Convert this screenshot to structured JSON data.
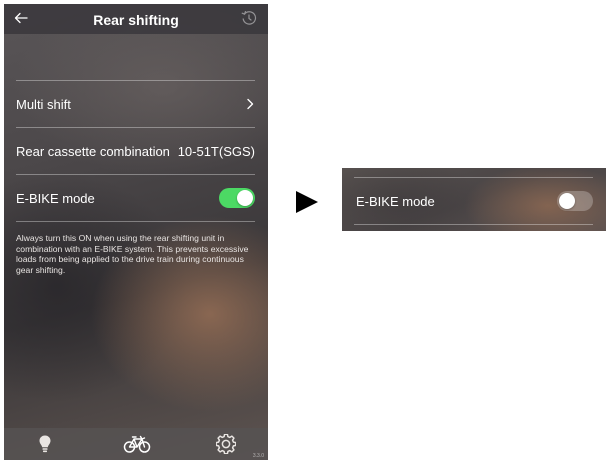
{
  "phone": {
    "header": {
      "title": "Rear shifting",
      "back_icon": "back-arrow-icon",
      "restore_icon": "restore-icon"
    },
    "rows": [
      {
        "label": "Multi shift",
        "value": "",
        "control": "chevron"
      },
      {
        "label": "Rear cassette combination",
        "value": "10-51T(SGS)",
        "control": "value"
      },
      {
        "label": "E-BIKE mode",
        "value": "",
        "control": "toggle",
        "toggle_on": true
      }
    ],
    "note": "Always turn this ON when using the rear shifting unit in combination with an E-BIKE system. This prevents excessive loads from being applied to the drive train during continuous gear shifting.",
    "bottom_tabs": [
      {
        "icon": "lightbulb-icon",
        "active": false
      },
      {
        "icon": "bicycle-icon",
        "active": true
      },
      {
        "icon": "gear-icon",
        "active": false
      }
    ],
    "version": "3.3.0"
  },
  "arrow_icon": "play-arrow-icon",
  "detail_panel": {
    "label": "E-BIKE mode",
    "toggle_on": false
  },
  "colors": {
    "toggle_on": "#4cd964",
    "toggle_off": "rgba(255,255,255,0.25)",
    "header_bg": "#3c3a3e"
  }
}
